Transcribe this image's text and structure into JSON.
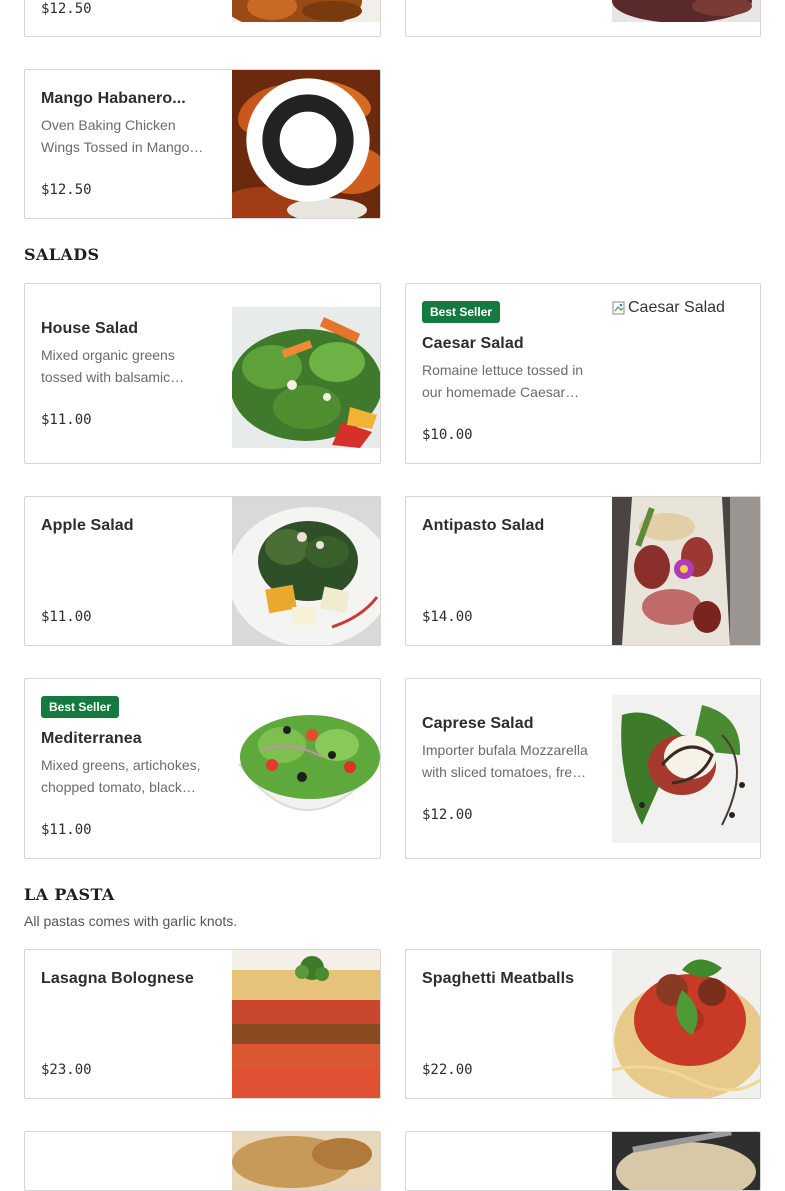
{
  "top_row": {
    "left_price": "$12.50"
  },
  "wings": {
    "name": "Mango Habanero...",
    "desc": "Oven Baking Chicken Wings Tossed in Mango Habanero sauce",
    "price": "$12.50",
    "image_icon": "chicken-wings-photo"
  },
  "salads": {
    "title": "SALADS",
    "items": [
      {
        "name": "House Salad",
        "desc": "Mixed organic greens tossed with balsamic vinaigrette",
        "price": "$11.00",
        "badge": "",
        "image_alt": ""
      },
      {
        "name": "Caesar Salad",
        "desc": "Romaine lettuce tossed in our homemade Caesar dressing",
        "price": "$10.00",
        "badge": "Best Seller",
        "image_alt": "Caesar Salad"
      },
      {
        "name": "Apple Salad",
        "desc": "",
        "price": "$11.00",
        "badge": "",
        "image_alt": ""
      },
      {
        "name": "Antipasto Salad",
        "desc": "",
        "price": "$14.00",
        "badge": "",
        "image_alt": ""
      },
      {
        "name": "Mediterranea",
        "desc": "Mixed greens, artichokes, chopped tomato, black olives",
        "price": "$11.00",
        "badge": "Best Seller",
        "image_alt": ""
      },
      {
        "name": "Caprese Salad",
        "desc": "Importer bufala Mozzarella with sliced tomatoes, fresh basil",
        "price": "$12.00",
        "badge": "",
        "image_alt": ""
      }
    ]
  },
  "pasta": {
    "title": "LA PASTA",
    "note": "All pastas comes with garlic knots.",
    "items": [
      {
        "name": "Lasagna Bolognese",
        "price": "$23.00"
      },
      {
        "name": "Spaghetti Meatballs",
        "price": "$22.00"
      }
    ]
  },
  "colors": {
    "badge_green": "#157a3f",
    "card_border": "#d6d6d6",
    "text_primary": "#2d2d2d",
    "text_secondary": "#6b6b6b"
  }
}
